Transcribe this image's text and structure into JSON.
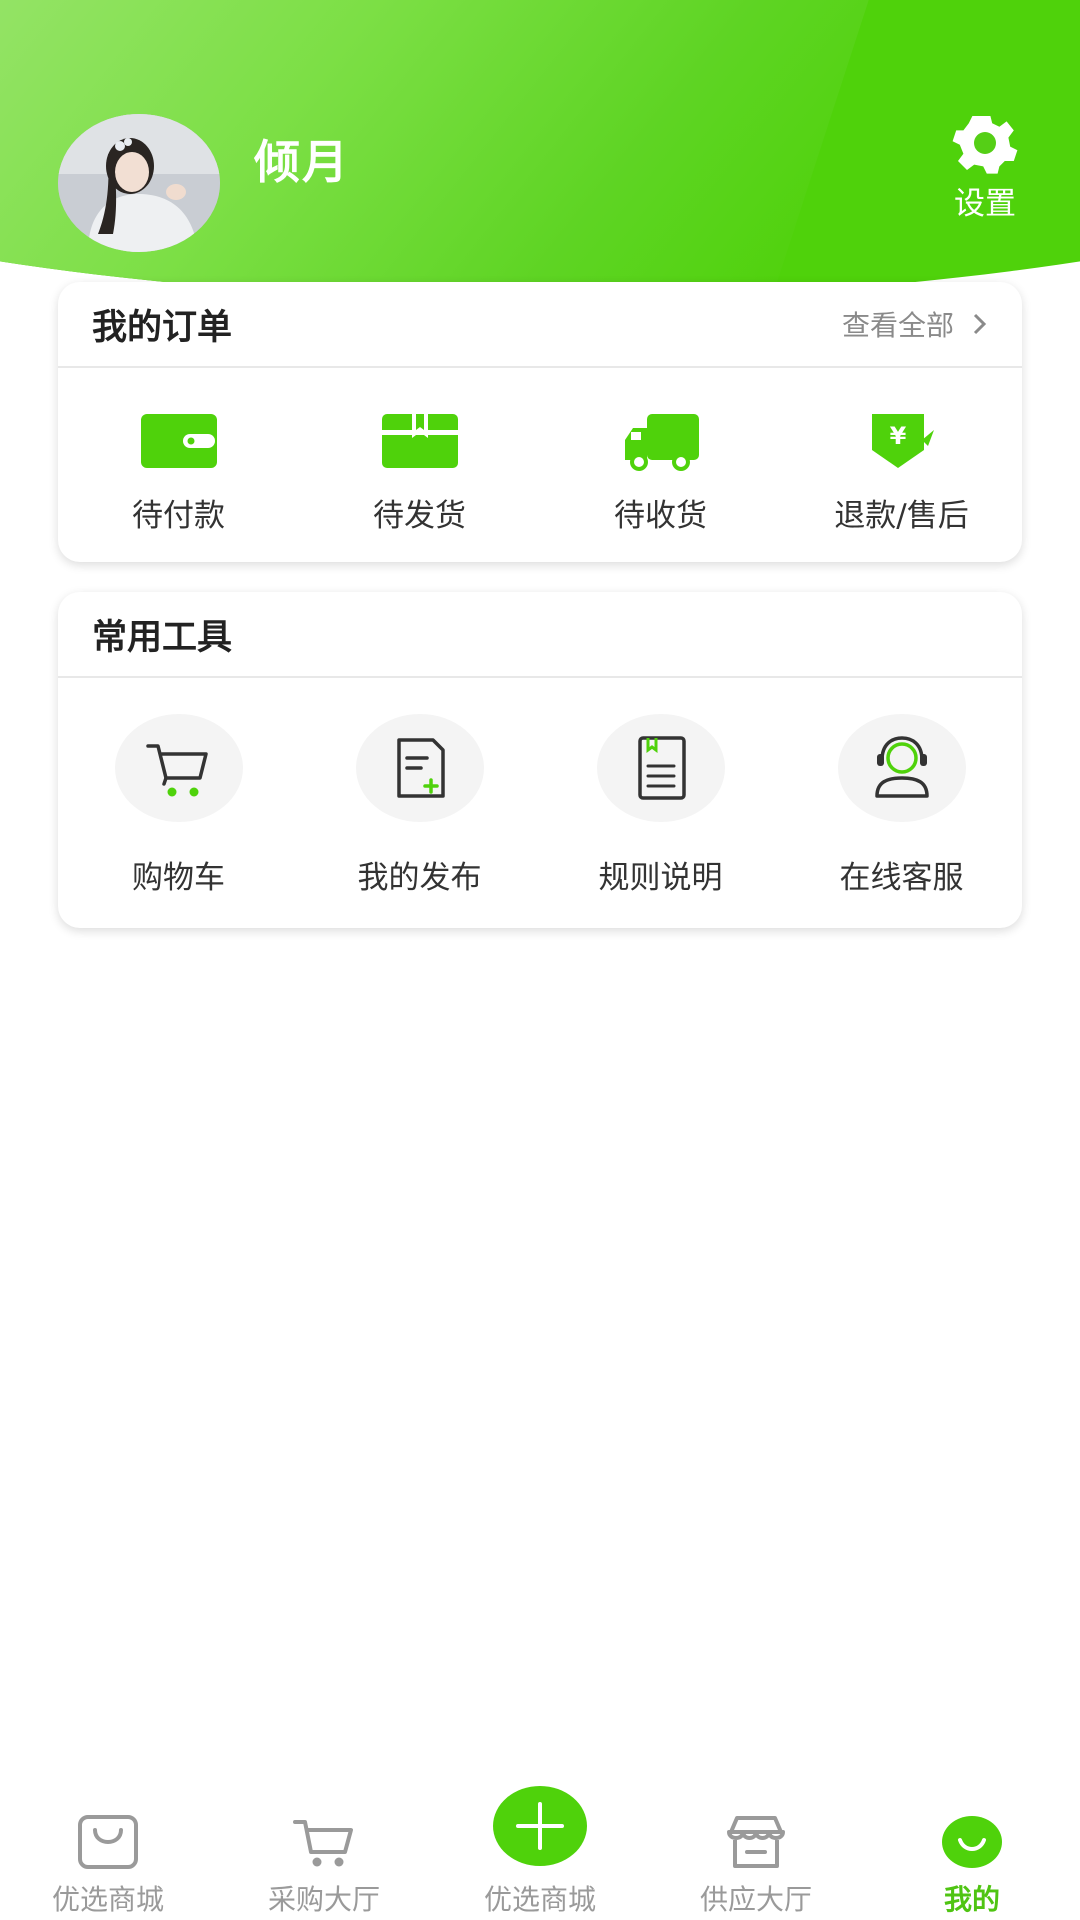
{
  "header": {
    "username": "倾月",
    "settings_label": "设置"
  },
  "orders": {
    "title": "我的订单",
    "view_all": "查看全部",
    "items": [
      {
        "label": "待付款",
        "icon": "wallet-icon"
      },
      {
        "label": "待发货",
        "icon": "package-icon"
      },
      {
        "label": "待收货",
        "icon": "truck-icon"
      },
      {
        "label": "退款/售后",
        "icon": "refund-icon"
      }
    ]
  },
  "tools": {
    "title": "常用工具",
    "items": [
      {
        "label": "购物车",
        "icon": "cart-icon"
      },
      {
        "label": "我的发布",
        "icon": "publish-icon"
      },
      {
        "label": "规则说明",
        "icon": "rules-icon"
      },
      {
        "label": "在线客服",
        "icon": "customer-service-icon"
      }
    ]
  },
  "bottom_nav": {
    "items": [
      {
        "label": "优选商城",
        "icon": "bag-icon",
        "active": false
      },
      {
        "label": "采购大厅",
        "icon": "cart-icon",
        "active": false
      },
      {
        "label": "优选商城",
        "icon": "plus-icon",
        "active": false
      },
      {
        "label": "供应大厅",
        "icon": "store-icon",
        "active": false
      },
      {
        "label": "我的",
        "icon": "smile-icon",
        "active": true
      }
    ]
  },
  "colors": {
    "accent": "#4fd20b",
    "active_nav": "#4fc412",
    "muted": "#9a9a9a"
  }
}
